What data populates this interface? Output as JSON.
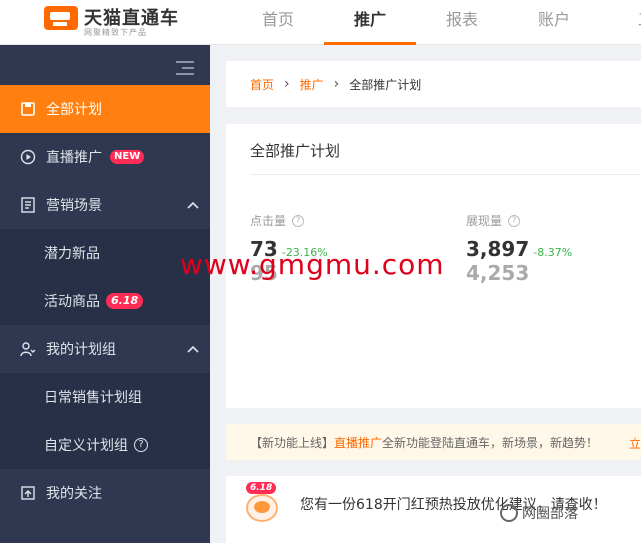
{
  "brand": {
    "name": "天猫直通车",
    "slogan": "网聚精致下产品"
  },
  "nav": {
    "items": [
      {
        "label": "首页",
        "active": false
      },
      {
        "label": "推广",
        "active": true
      },
      {
        "label": "报表",
        "active": false
      },
      {
        "label": "账户",
        "active": false
      },
      {
        "label": "工",
        "active": false
      }
    ]
  },
  "sidebar": {
    "items": [
      {
        "label": "全部计划",
        "icon": "save-icon",
        "active": true
      },
      {
        "label": "直播推广",
        "icon": "play-icon",
        "badge": "NEW"
      },
      {
        "label": "营销场景",
        "icon": "document-icon",
        "expanded": true
      },
      {
        "label": "潜力新品",
        "sub": true
      },
      {
        "label": "活动商品",
        "sub": true,
        "badge": "6.18"
      },
      {
        "label": "我的计划组",
        "icon": "user-group-icon",
        "expanded": true
      },
      {
        "label": "日常销售计划组",
        "sub": true
      },
      {
        "label": "自定义计划组",
        "sub": true,
        "help": "?"
      },
      {
        "label": "我的关注",
        "icon": "upload-icon"
      }
    ]
  },
  "breadcrumb": {
    "home": "首页",
    "promotion": "推广",
    "current": "全部推广计划"
  },
  "plan": {
    "title": "全部推广计划",
    "metrics": [
      {
        "label": "点击量",
        "value": "73",
        "change": "-23.16%",
        "previous": "95"
      },
      {
        "label": "展现量",
        "value": "3,897",
        "change": "-8.37%",
        "previous": "4,253"
      }
    ]
  },
  "watermark": "www.gmgmu.com",
  "notice": {
    "prefix": "【新功能上线】",
    "link": "直播推广",
    "text": "全新功能登陆直通车，新场景，新趋势！",
    "right_link": "立"
  },
  "promo": {
    "tag": "6.18",
    "text": "您有一份618开门红预热投放优化建议，请查收！"
  },
  "footer_brand": "网圈部落",
  "colors": {
    "accent": "#ff6a00",
    "sidebar": "#2f3850",
    "positive": "#3ab54a",
    "badge": "#ff2d55"
  }
}
